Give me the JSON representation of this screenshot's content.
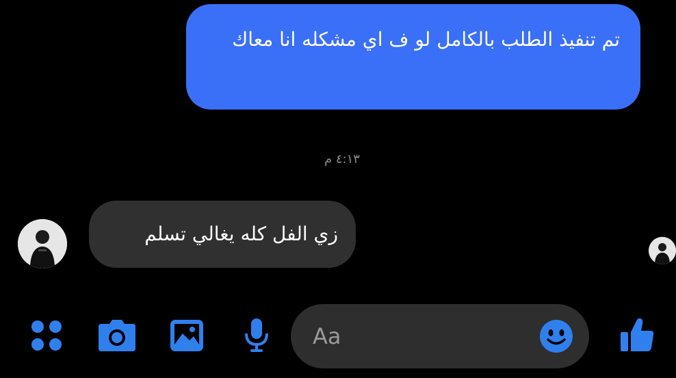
{
  "conversation": {
    "outgoing_message": "تم تنفيذ الطلب بالكامل لو ف اي مشكله انا معاك",
    "timestamp": "٤:١٣ م",
    "incoming_message": "زي الفل كله يغالي تسلم"
  },
  "composer": {
    "placeholder": "Aa"
  },
  "icons": {
    "apps": "apps-grid-icon",
    "camera": "camera-icon",
    "gallery": "image-icon",
    "mic": "microphone-icon",
    "emoji": "emoji-icon",
    "like": "thumbs-up-icon"
  },
  "colors": {
    "accent": "#3a6ff7",
    "icon_blue": "#2f80ed",
    "incoming_bubble": "#303030",
    "composer_bg": "#2e2e2e",
    "background": "#000000",
    "timestamp": "#8a8d91"
  }
}
